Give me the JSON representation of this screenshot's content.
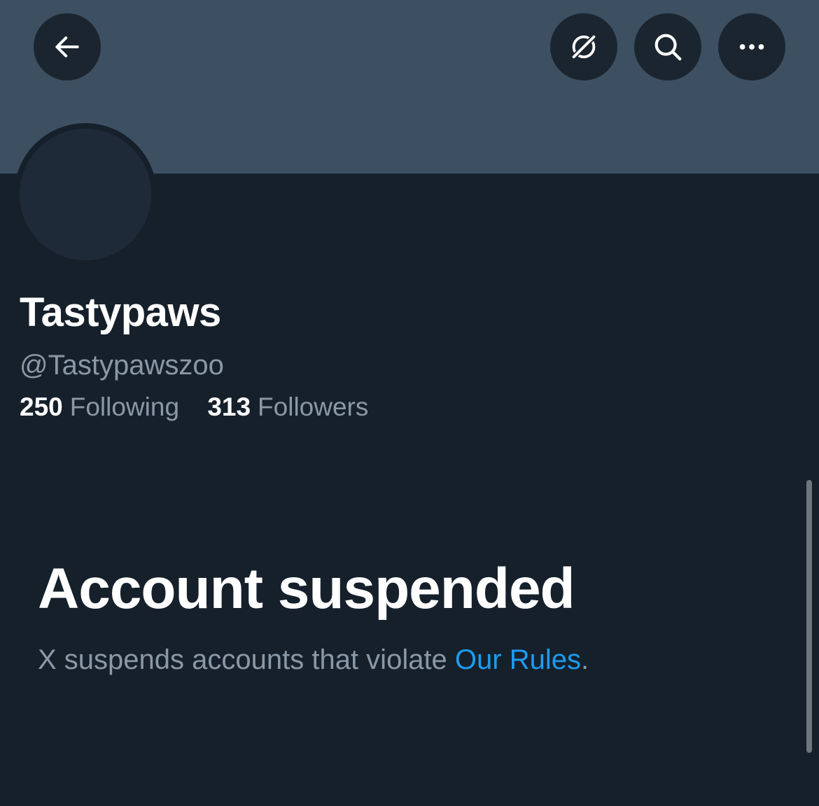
{
  "header": {
    "back_icon": "arrow-left-icon",
    "grok_icon": "grok-icon",
    "search_icon": "search-icon",
    "more_icon": "more-dots-icon"
  },
  "profile": {
    "display_name": "Tastypaws",
    "handle": "@Tastypawszoo",
    "following_count": "250",
    "following_label": "Following",
    "followers_count": "313",
    "followers_label": "Followers"
  },
  "suspension": {
    "title": "Account suspended",
    "message_prefix": "X suspends accounts that violate ",
    "rules_link": "Our Rules",
    "message_suffix": "."
  },
  "colors": {
    "background": "#15202b",
    "banner": "#3d5062",
    "accent_link": "#1d9bf0",
    "secondary_text": "#8b98a5"
  }
}
